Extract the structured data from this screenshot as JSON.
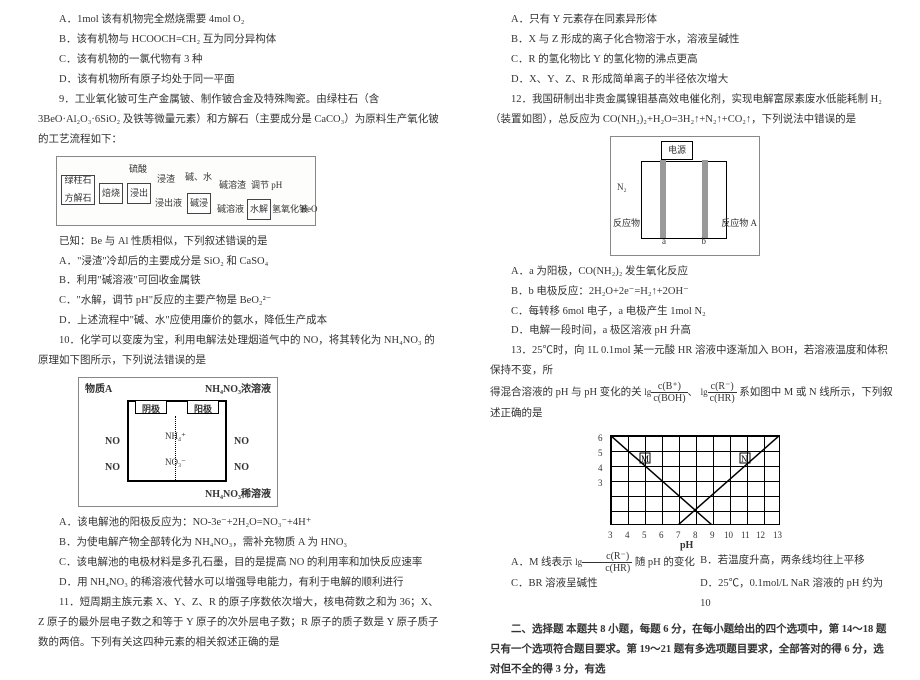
{
  "left": {
    "q8A": "A．1mol 该有机物完全燃烧需要 4mol O₂",
    "q8B": "B．该有机物与 HCOOCH=CH₂ 互为同分异构体",
    "q8C": "C．该有机物的一氯代物有 3 种",
    "q8D": "D．该有机物所有原子均处于同一平面",
    "q9": "9．工业氧化铍可生产金属铍、制作铍合金及特殊陶瓷。由绿柱石（含 3BeO·Al₂O₃·6SiO₂ 及铁等微量元素）和方解石（主要成分是 CaCO₃）为原料生产氧化铍的工艺流程如下：",
    "d1": {
      "a": "绿柱石",
      "b": "方解石",
      "c": "焙烧",
      "d": "浸出",
      "e": "硫酸",
      "f": "浸渣",
      "g": "浸出液",
      "h": "碱浸",
      "i": "碱、水",
      "j": "碱溶渣",
      "k": "碱溶液",
      "l": "调节 pH",
      "m": "水解",
      "n": "氢氧化铍",
      "o": "BeO"
    },
    "q9pre": "已知：Be 与 Al 性质相似，下列叙述错误的是",
    "q9A": "A．\"浸渣\"冷却后的主要成分是 SiO₂ 和 CaSO₄",
    "q9B": "B．利用\"碱溶液\"可回收金属铁",
    "q9C": "C．\"水解，调节 pH\"反应的主要产物是 BeO₂²⁻",
    "q9D": "D．上述流程中\"碱、水\"应使用廉价的氨水，降低生产成本",
    "q10": "10．化学可以变废为宝，利用电解法处理烟道气中的 NO，将其转化为 NH₄NO₃ 的原理如下图所示，下列说法错误的是",
    "d2": {
      "top": "NH₄NO₃浓溶液",
      "bot": "NH₄NO₃稀溶液",
      "mat": "物质A",
      "an": "阳极",
      "ca": "阴极",
      "nh4": "NH₄⁺",
      "no3": "NO₃⁻",
      "no": "NO"
    },
    "q10A": "A．该电解池的阳极反应为：NO-3e⁻+2H₂O=NO₃⁻+4H⁺",
    "q10B": "B．为使电解产物全部转化为 NH₄NO₃，需补充物质 A 为 HNO₃",
    "q10C": "C．该电解池的电极材料是多孔石墨，目的是提高 NO 的利用率和加快反应速率",
    "q10D": "D．用 NH₄NO₃ 的稀溶液代替水可以增强导电能力，有利于电解的顺利进行",
    "q11": "11．短周期主族元素 X、Y、Z、R 的原子序数依次增大，核电荷数之和为 36；X、Z 原子的最外层电子数之和等于 Y 原子的次外层电子数；R 原子的质子数是 Y 原子质子数的两倍。下列有关这四种元素的相关叙述正确的是"
  },
  "right": {
    "q11A": "A．只有 Y 元素存在同素异形体",
    "q11B": "B．X 与 Z 形成的离子化合物溶于水，溶液呈碱性",
    "q11C": "C．R 的氢化物比 Y 的氢化物的沸点更高",
    "q11D": "D．X、Y、Z、R 形成简单离子的半径依次增大",
    "q12": "12．我国研制出非贵金属镍钼基高效电催化剂，实现电解富尿素废水低能耗制 H₂（装置如图），总反应为 CO(NH₂)₂+H₂O=3H₂↑+N₂↑+CO₂↑，下列说法中错误的是",
    "d3": {
      "ele": "电源",
      "n2": "N₂",
      "a": "a",
      "b": "b",
      "rx": "反应物 A"
    },
    "q12A": "A．a 为阳极，CO(NH₂)₂ 发生氧化反应",
    "q12B": "B．b 电极反应：2H₂O+2e⁻=H₂↑+2OH⁻",
    "q12C": "C．每转移 6mol 电子，a 电极产生 1mol N₂",
    "q12D": "D．电解一段时间，a 极区溶液 pH 升高",
    "q13a": "13．25℃时，向 1L 0.1mol 某一元酸 HR 溶液中逐渐加入 BOH，若溶液温度和体积保持不变，所",
    "q13b": "得混合溶液的 pH 与 pH 变化的关",
    "q13c": "系如图中 M 或 N 线所示，下列叙述正确的是",
    "fr1t": "c(B⁺)",
    "fr1b": "c(BOH)",
    "fr2t": "c(R⁻)",
    "fr2b": "c(HR)",
    "q13A1": "A．M 线表示 ",
    "q13A2": " 随 pH 的变化",
    "q13B": "B．若温度升高，两条线均往上平移",
    "q13C": "C．BR 溶液呈碱性",
    "q13D": "D．25℃，0.1mol/L NaR 溶液的 pH 约为 10",
    "sec": "二、选择题  本题共 8 小题，每题 6 分，在每小题给出的四个选项中，第 14～18 题只有一个选项符合题目要求。第 19～21 题有多选项题目要求，全部答对的得 6 分，选对但不全的得 3 分，有选"
  },
  "chart_data": {
    "type": "line",
    "title": "",
    "xlabel": "pH",
    "ylabel": "",
    "x_ticks": [
      3,
      4,
      5,
      6,
      7,
      8,
      9,
      10,
      11,
      12,
      13
    ],
    "y_ticks": [
      3,
      4,
      5,
      6
    ],
    "series": [
      {
        "name": "M",
        "points": [
          [
            3,
            6
          ],
          [
            9,
            0
          ]
        ]
      },
      {
        "name": "N",
        "points": [
          [
            7,
            0
          ],
          [
            13,
            6
          ]
        ]
      }
    ],
    "annotations": [
      {
        "label": "M",
        "x": 5,
        "y": 4.5
      },
      {
        "label": "N",
        "x": 11,
        "y": 4.5
      }
    ],
    "xlim": [
      3,
      13
    ],
    "ylim": [
      0,
      6
    ]
  }
}
